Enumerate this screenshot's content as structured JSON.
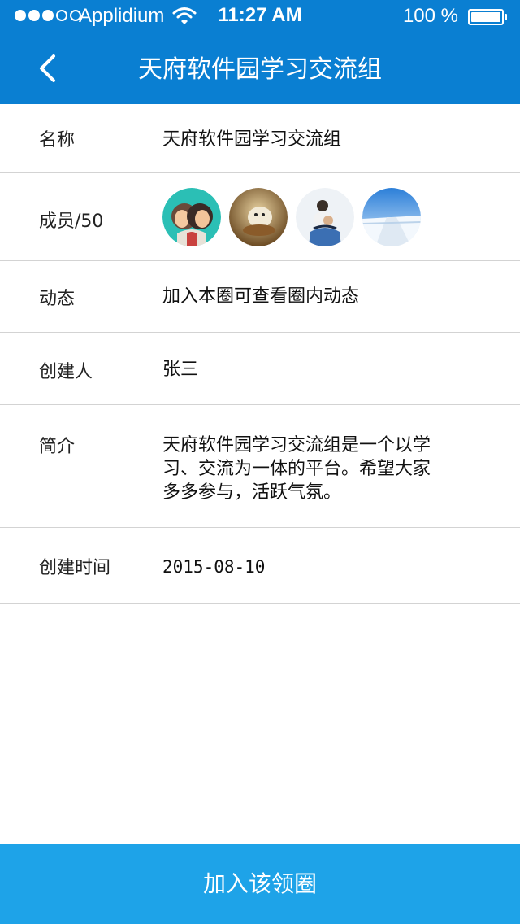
{
  "status_bar": {
    "signal_icon": "signal-dots-icon",
    "carrier": "Applidium",
    "wifi_icon": "wifi-icon",
    "time": "11:27 AM",
    "battery_percent": "100 %",
    "battery_icon": "battery-icon",
    "battery_level": 1.0
  },
  "nav": {
    "back_icon": "chevron-left-icon",
    "title": "天府软件园学习交流组"
  },
  "rows": {
    "name": {
      "label": "名称",
      "value": "天府软件园学习交流组"
    },
    "members": {
      "label": "成员/50",
      "avatars": [
        "avatar-cartoon-couple",
        "avatar-animal-photo",
        "avatar-family-photo",
        "avatar-snow-landscape"
      ]
    },
    "activity": {
      "label": "动态",
      "value": "加入本圈可查看圈内动态"
    },
    "creator": {
      "label": "创建人",
      "value": "张三"
    },
    "intro": {
      "label": "简介",
      "lines": [
        "天府软件园学习交流组是一个以学",
        "习、交流为一体的平台。希望大家",
        "多多参与，活跃气氛。"
      ]
    },
    "created": {
      "label": "创建时间",
      "value": "2015-08-10"
    }
  },
  "footer": {
    "join_label": "加入该领圈"
  },
  "colors": {
    "header": "#0a7fd2",
    "footer_button": "#1ea3e8",
    "divider": "#d3d3d3"
  }
}
